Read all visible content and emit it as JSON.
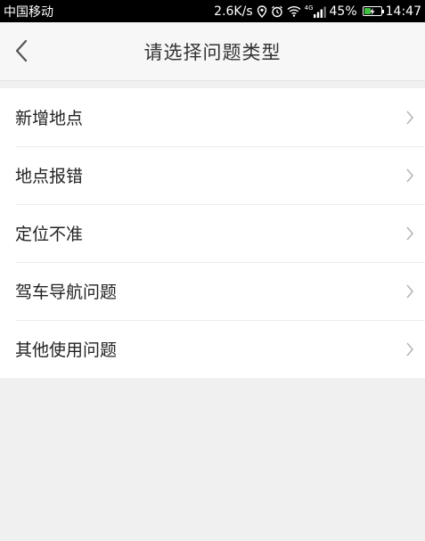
{
  "status_bar": {
    "carrier": "中国移动",
    "network_speed": "2.6K/s",
    "signal_label": "4G",
    "battery_percent": "45%",
    "battery_level": 0.45,
    "time": "14:47"
  },
  "nav": {
    "title": "请选择问题类型",
    "back_icon": "chevron-left-icon"
  },
  "items": [
    {
      "label": "新增地点"
    },
    {
      "label": "地点报错"
    },
    {
      "label": "定位不准"
    },
    {
      "label": "驾车导航问题"
    },
    {
      "label": "其他使用问题"
    }
  ],
  "colors": {
    "background": "#f0f0f0",
    "battery_fill": "#3fbf3f",
    "chevron": "#b0b0b0"
  }
}
